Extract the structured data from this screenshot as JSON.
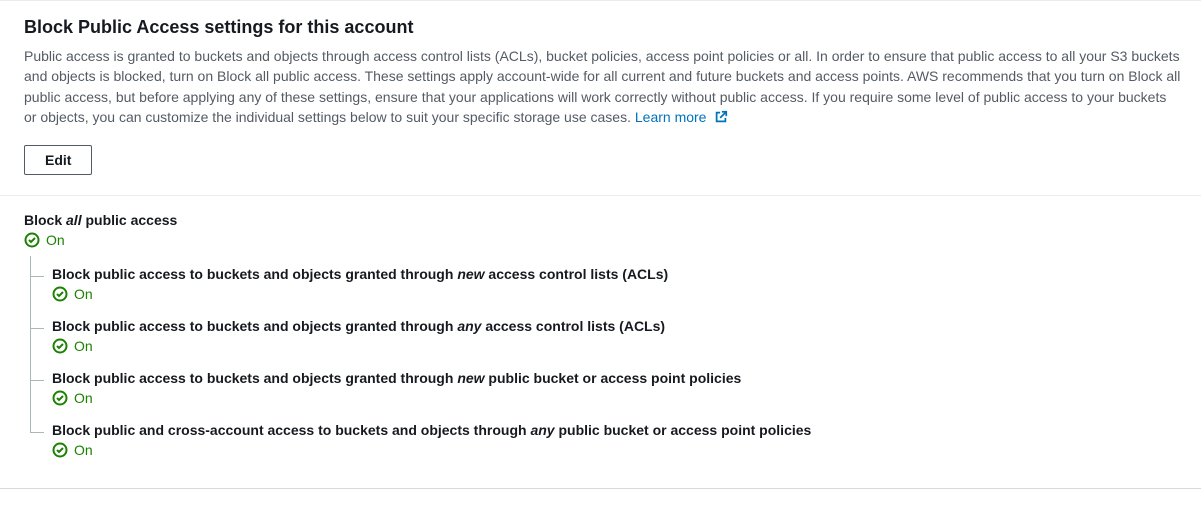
{
  "header": {
    "title": "Block Public Access settings for this account",
    "description": "Public access is granted to buckets and objects through access control lists (ACLs), bucket policies, access point policies or all. In order to ensure that public access to all your S3 buckets and objects is blocked, turn on Block all public access. These settings apply account-wide for all current and future buckets and access points. AWS recommends that you turn on Block all public access, but before applying any of these settings, ensure that your applications will work correctly without public access. If you require some level of public access to your buckets or objects, you can customize the individual settings below to suit your specific storage use cases. ",
    "learn_more": "Learn more",
    "edit_label": "Edit"
  },
  "block_all": {
    "title_prefix": "Block ",
    "title_em": "all",
    "title_suffix": " public access",
    "status": "On"
  },
  "sub_settings": [
    {
      "title_prefix": "Block public access to buckets and objects granted through ",
      "title_em": "new",
      "title_suffix": " access control lists (ACLs)",
      "status": "On"
    },
    {
      "title_prefix": "Block public access to buckets and objects granted through ",
      "title_em": "any",
      "title_suffix": " access control lists (ACLs)",
      "status": "On"
    },
    {
      "title_prefix": "Block public access to buckets and objects granted through ",
      "title_em": "new",
      "title_suffix": " public bucket or access point policies",
      "status": "On"
    },
    {
      "title_prefix": "Block public and cross-account access to buckets and objects through ",
      "title_em": "any",
      "title_suffix": " public bucket or access point policies",
      "status": "On"
    }
  ],
  "colors": {
    "success": "#1d8102",
    "link": "#0073bb"
  }
}
